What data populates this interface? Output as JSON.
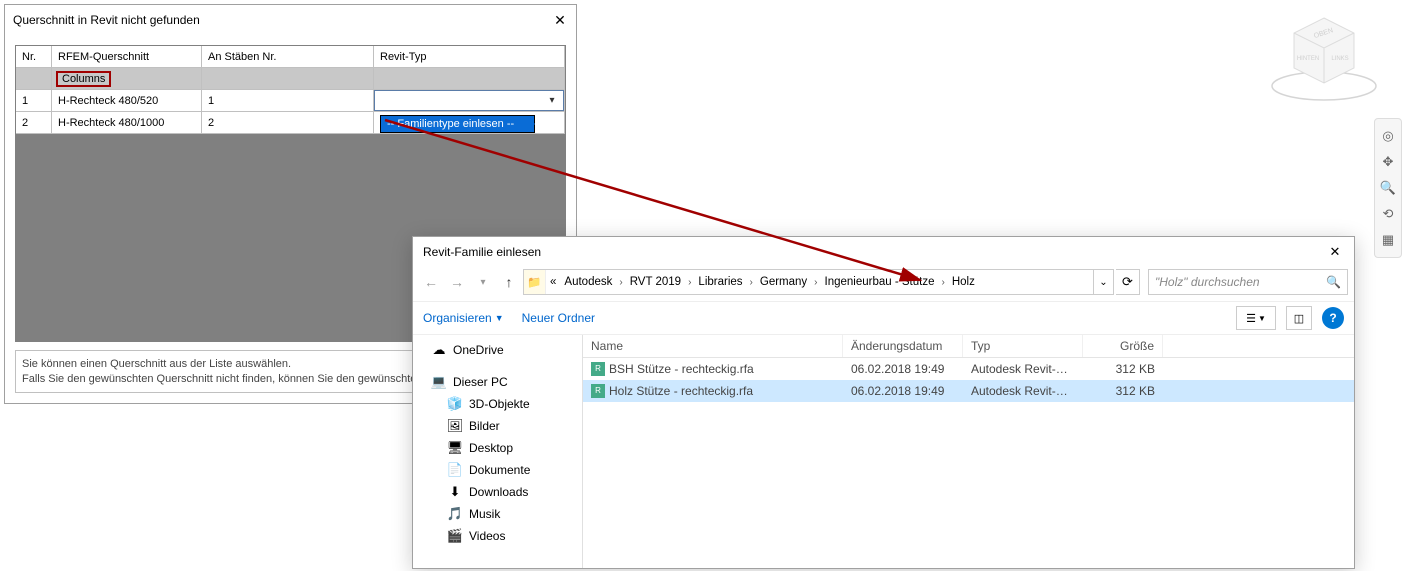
{
  "dialog1": {
    "title": "Querschnitt in Revit nicht gefunden",
    "columns": {
      "nr": "Nr.",
      "rfem": "RFEM-Querschnitt",
      "stab": "An Stäben Nr.",
      "revit": "Revit-Typ"
    },
    "group": "Columns",
    "rows": [
      {
        "nr": "1",
        "rfem": "H-Rechteck 480/520",
        "stab": "1"
      },
      {
        "nr": "2",
        "rfem": "H-Rechteck 480/1000",
        "stab": "2"
      }
    ],
    "dropdown_item": "-- Familientype einlesen --",
    "footer_l1": "Sie können einen Querschnitt aus der Liste auswählen.",
    "footer_l2": "Falls Sie den gewünschten Querschnitt nicht finden, können Sie den gewünschten Typ einlesen."
  },
  "dialog2": {
    "title": "Revit-Familie einlesen",
    "breadcrumb": [
      "«",
      "Autodesk",
      "RVT 2019",
      "Libraries",
      "Germany",
      "Ingenieurbau - Stütze",
      "Holz"
    ],
    "search_placeholder": "\"Holz\" durchsuchen",
    "toolbar": {
      "organize": "Organisieren",
      "new_folder": "Neuer Ordner"
    },
    "tree": [
      {
        "icon": "cloud",
        "label": "OneDrive"
      },
      {
        "icon": "pc",
        "label": "Dieser PC",
        "expanded": true
      },
      {
        "icon": "3d",
        "label": "3D-Objekte",
        "sub": true
      },
      {
        "icon": "img",
        "label": "Bilder",
        "sub": true
      },
      {
        "icon": "desk",
        "label": "Desktop",
        "sub": true
      },
      {
        "icon": "doc",
        "label": "Dokumente",
        "sub": true
      },
      {
        "icon": "dl",
        "label": "Downloads",
        "sub": true
      },
      {
        "icon": "music",
        "label": "Musik",
        "sub": true
      },
      {
        "icon": "vid",
        "label": "Videos",
        "sub": true
      }
    ],
    "file_columns": {
      "name": "Name",
      "date": "Änderungsdatum",
      "type": "Typ",
      "size": "Größe"
    },
    "files": [
      {
        "name": "BSH Stütze - rechteckig.rfa",
        "date": "06.02.2018 19:49",
        "type": "Autodesk Revit-Fa...",
        "size": "312 KB",
        "selected": false
      },
      {
        "name": "Holz Stütze - rechteckig.rfa",
        "date": "06.02.2018 19:49",
        "type": "Autodesk Revit-Fa...",
        "size": "312 KB",
        "selected": true
      }
    ]
  },
  "viewcube": {
    "top": "OBEN",
    "left": "HINTEN",
    "right": "LINKS"
  }
}
